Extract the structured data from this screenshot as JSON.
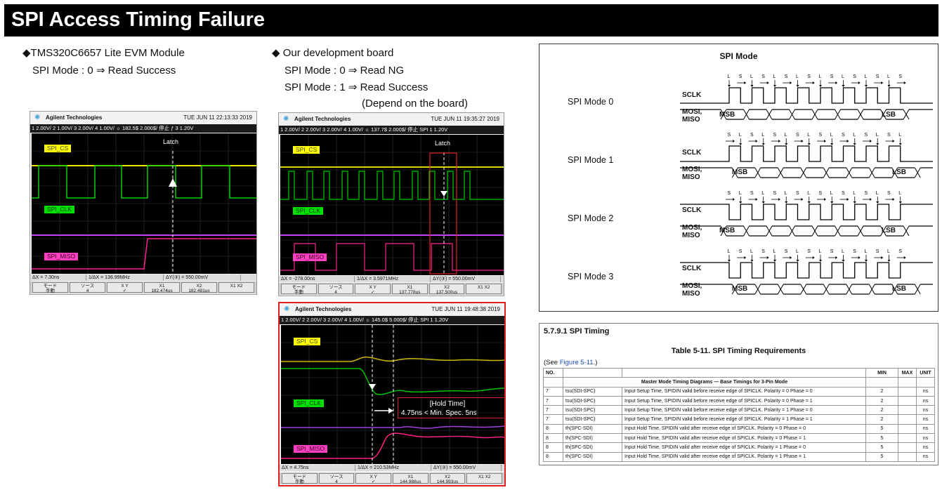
{
  "title": "SPI Access Timing Failure",
  "left": {
    "heading": "◆TMS320C6657 Lite EVM Module",
    "line1": "SPI Mode : 0 ⇒ Read Success"
  },
  "middle": {
    "heading": "◆ Our development board",
    "line1": "SPI Mode : 0 ⇒ Read NG",
    "line2": "SPI Mode : 1  ⇒ Read Success",
    "line3": "(Depend on the board)"
  },
  "scopes": [
    {
      "brand": "Agilent Technologies",
      "date": "TUE JUN 11 22:13:33 2019",
      "status": "1  2.00V/   2  1.00V/   3  2.00V/   4  1.00V/   ☼   182.5$   2.000$/   停止   ƒ   3   1.20V",
      "latch": "Latch",
      "labels": {
        "cs": "SPI_CS",
        "clk": "SPI_CLK",
        "miso": "SPI_MISO"
      },
      "meas": [
        "ΔX = 7.30ns",
        "1/ΔX = 136.99MHz",
        "ΔY(③) = 550.00mV"
      ],
      "buttons": [
        "モード\n手動",
        "ソース\n4",
        "X    Y\n✓",
        "X1\n182.474us",
        "X2\n182.481us",
        "X1 X2"
      ]
    },
    {
      "brand": "Agilent Technologies",
      "date": "TUE JUN 11 19:35:27 2019",
      "status": "1  2.00V/   2  2.00V/   3  2.00V/   4  1.00V/   ☼   137.7$   2.000$/   停止   SPI   1   1.20V",
      "latch": "Latch",
      "labels": {
        "cs": "SPI_CS",
        "clk": "SPI_CLK",
        "miso": "SPI_MISO"
      },
      "meas": [
        "ΔX = -278.00ns",
        "1/ΔX = 3.5971MHz",
        "ΔY(③) = 550.00mV"
      ],
      "buttons": [
        "モード\n手動",
        "ソース\n4",
        "X    Y\n✓",
        "X1\n137.778us",
        "X2\n137.500us",
        "X1 X2"
      ]
    },
    {
      "brand": "Agilent Technologies",
      "date": "TUE JUN 11 19:48:38 2019",
      "status": "1  2.00V/   2  2.00V/   3  2.00V/   4  1.00V/   ☼   145.0$   5.000$/   停止   SPI   1   1.20V",
      "labels": {
        "cs": "SPI_CS",
        "clk": "SPI_CLK",
        "miso": "SPI_MISO"
      },
      "hold1": "[Hold Time]",
      "hold2": "4.75ns < Min. Spec. 5ns",
      "meas": [
        "ΔX = 4.75ns",
        "1/ΔX = 210.53MHz",
        "ΔY(③) = 550.00mV"
      ],
      "buttons": [
        "モード\n手動",
        "ソース\n4",
        "X    Y\n✓",
        "X1\n144.988us",
        "X2\n144.993us",
        "X1 X2"
      ]
    }
  ],
  "spi_modes": {
    "title": "SPI Mode",
    "sclk": "SCLK",
    "mosi": "MOSI,",
    "miso": "MISO",
    "msb": "MSB",
    "lsb": "LSB",
    "modes": [
      "SPI Mode 0",
      "SPI Mode 1",
      "SPI Mode 2",
      "SPI Mode 3"
    ]
  },
  "table": {
    "section": "5.7.9.1    SPI Timing",
    "title": "Table 5-11. SPI Timing Requirements",
    "see_prefix": "(See ",
    "see_link": "Figure 5-11",
    "see_suffix": ".)",
    "headers": [
      "NO.",
      "",
      "",
      "MIN",
      "MAX",
      "UNIT"
    ],
    "group": "Master Mode Timing Diagrams — Base Timings for 3-Pin Mode",
    "rows": [
      [
        "7",
        "tsu(SDI-SPC)",
        "Input Setup Time, SPIDIN valid before receive edge of SPICLK. Polarity = 0 Phase = 0",
        "2",
        "",
        "ns"
      ],
      [
        "7",
        "tsu(SDI-SPC)",
        "Input Setup Time, SPIDIN valid before receive edge of SPICLK. Polarity = 0 Phase = 1",
        "2",
        "",
        "ns"
      ],
      [
        "7",
        "tsu(SDI-SPC)",
        "Input Setup Time, SPIDIN valid before receive edge of SPICLK. Polarity = 1 Phase = 0",
        "2",
        "",
        "ns"
      ],
      [
        "7",
        "tsu(SDI-SPC)",
        "Input Setup Time, SPIDIN valid before receive edge of SPICLK. Polarity = 1 Phase = 1",
        "2",
        "",
        "ns"
      ],
      [
        "8",
        "th(SPC-SDI)",
        "Input Hold Time, SPIDIN valid after receive edge of SPICLK. Polarity = 0 Phase = 0",
        "5",
        "",
        "ns"
      ],
      [
        "8",
        "th(SPC-SDI)",
        "Input Hold Time, SPIDIN valid after receive edge of SPICLK. Polarity = 0 Phase = 1",
        "5",
        "",
        "ns"
      ],
      [
        "8",
        "th(SPC-SDI)",
        "Input Hold Time, SPIDIN valid after receive edge of SPICLK. Polarity = 1 Phase = 0",
        "5",
        "",
        "ns"
      ],
      [
        "8",
        "th(SPC-SDI)",
        "Input Hold Time, SPIDIN valid after receive edge of SPICLK. Polarity = 1 Phase = 1",
        "5",
        "",
        "ns"
      ]
    ]
  }
}
